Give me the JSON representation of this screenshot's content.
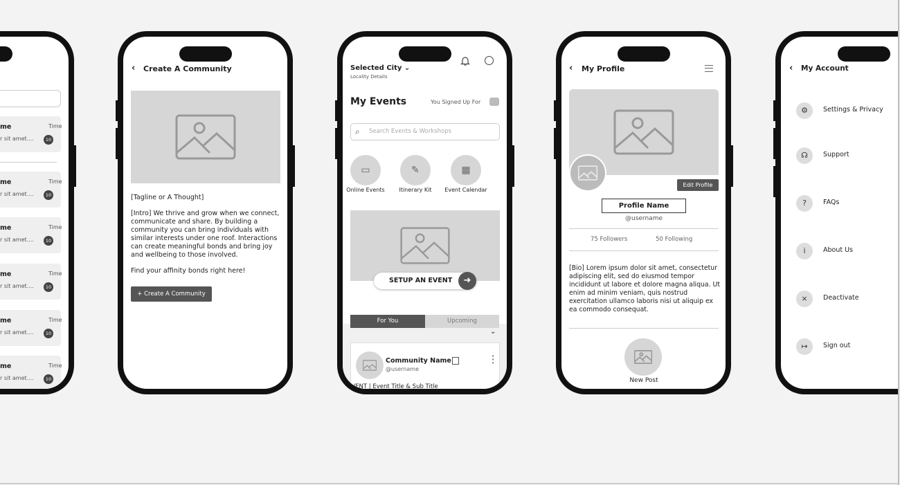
{
  "phone1": {
    "item_title": "me",
    "item_time": "Time",
    "item_preview": "r sit amet....",
    "item_badge": "10"
  },
  "create_community": {
    "title": "Create A Community",
    "tagline": "[Tagline or A Thought]",
    "intro": "[Intro] We thrive and grow when we connect, communicate and share. By building a community you can bring individuals with similar interests under one roof. Interactions can create meaningful bonds and bring joy and wellbeing to those involved.",
    "cta_text": "Find your affinity bonds right here!",
    "button": "+ Create A Community"
  },
  "events": {
    "city": "Selected City",
    "locality": "Locality Details",
    "title": "My Events",
    "signed_up": "You Signed Up For",
    "search_placeholder": "Search Events & Workshops",
    "quick": [
      {
        "label": "Online Events",
        "icon": "video-icon"
      },
      {
        "label": "Itinerary Kit",
        "icon": "edit-icon"
      },
      {
        "label": "Event Calendar",
        "icon": "calendar-icon"
      }
    ],
    "setup_button": "SETUP AN EVENT",
    "tabs": [
      "For You",
      "Upcoming"
    ],
    "active_tab": "For You",
    "card": {
      "community": "Community Name",
      "username": "@username",
      "event_line": "EVENT | Event Title & Sub Title"
    }
  },
  "profile": {
    "title": "My Profile",
    "edit": "Edit Profile",
    "name": "Profile Name",
    "username": "@username",
    "followers": "75 Followers",
    "following": "50 Following",
    "bio": "[Bio] Lorem ipsum dolor sit amet, consectetur adipiscing elit, sed do eiusmod tempor incididunt ut labore et dolore magna aliqua. Ut enim ad minim veniam, quis nostrud exercitation ullamco laboris nisi ut aliquip ex ea commodo consequat.",
    "new_post": "New Post"
  },
  "account": {
    "title": "My Account",
    "items": [
      {
        "label": "Settings & Privacy",
        "icon": "gear-icon"
      },
      {
        "label": "Support",
        "icon": "headset-icon"
      },
      {
        "label": "FAQs",
        "icon": "faq-book-icon"
      },
      {
        "label": "About Us",
        "icon": "info-icon"
      },
      {
        "label": "Deactivate",
        "icon": "close-circle-icon"
      },
      {
        "label": "Sign out",
        "icon": "sign-out-icon"
      }
    ]
  },
  "colors": {
    "dark": "#555555",
    "placeholder": "#d6d6d6",
    "background": "#f3f3f3"
  }
}
